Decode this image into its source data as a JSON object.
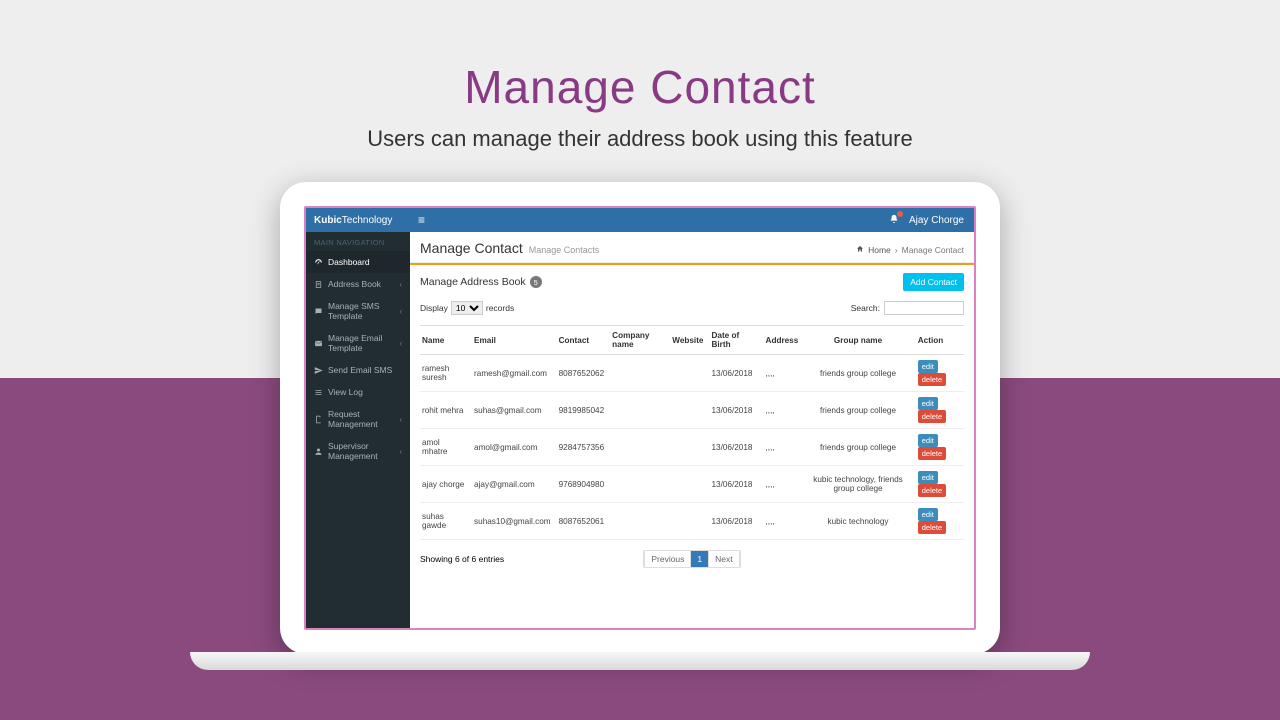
{
  "hero": {
    "title": "Manage Contact",
    "subtitle": "Users can manage their address book using this feature"
  },
  "brand": {
    "bold": "Kubic",
    "light": "Technology"
  },
  "topbar": {
    "user": "Ajay Chorge"
  },
  "sidebar": {
    "section": "MAIN NAVIGATION",
    "items": [
      {
        "label": "Dashboard",
        "expandable": false
      },
      {
        "label": "Address Book",
        "expandable": true
      },
      {
        "label": "Manage SMS Template",
        "expandable": true
      },
      {
        "label": "Manage Email Template",
        "expandable": true
      },
      {
        "label": "Send Email SMS",
        "expandable": false
      },
      {
        "label": "View Log",
        "expandable": false
      },
      {
        "label": "Request Management",
        "expandable": true
      },
      {
        "label": "Supervisor Management",
        "expandable": true
      }
    ]
  },
  "crumb": {
    "title": "Manage Contact",
    "sub": "Manage Contacts",
    "home": "Home",
    "current": "Manage Contact"
  },
  "panel": {
    "title": "Manage Address Book",
    "count": "5",
    "add": "Add Contact"
  },
  "controls": {
    "display": "Display",
    "records": "records",
    "perpage": "10",
    "searchLabel": "Search:"
  },
  "columns": {
    "name": "Name",
    "email": "Email",
    "contact": "Contact",
    "company": "Company name",
    "website": "Website",
    "dob": "Date of Birth",
    "address": "Address",
    "group": "Group name",
    "action": "Action"
  },
  "rows": [
    {
      "name": "ramesh suresh",
      "email": "ramesh@gmail.com",
      "contact": "8087652062",
      "company": "",
      "website": "",
      "dob": "13/06/2018",
      "address": ",,,,",
      "group": "friends group college"
    },
    {
      "name": "rohit mehra",
      "email": "suhas@gmail.com",
      "contact": "9819985042",
      "company": "",
      "website": "",
      "dob": "13/06/2018",
      "address": ",,,,",
      "group": "friends group college"
    },
    {
      "name": "amol mhatre",
      "email": "amol@gmail.com",
      "contact": "9284757356",
      "company": "",
      "website": "",
      "dob": "13/06/2018",
      "address": ",,,,",
      "group": "friends group college"
    },
    {
      "name": "ajay chorge",
      "email": "ajay@gmail.com",
      "contact": "9768904980",
      "company": "",
      "website": "",
      "dob": "13/06/2018",
      "address": ",,,,",
      "group": "kubic technology, friends group college"
    },
    {
      "name": "suhas gawde",
      "email": "suhas10@gmail.com",
      "contact": "8087652061",
      "company": "",
      "website": "",
      "dob": "13/06/2018",
      "address": ",,,,",
      "group": "kubic technology"
    }
  ],
  "actions": {
    "edit": "edit",
    "delete": "delete"
  },
  "footer": {
    "info": "Showing 6 of 6 entries",
    "prev": "Previous",
    "page": "1",
    "next": "Next"
  }
}
